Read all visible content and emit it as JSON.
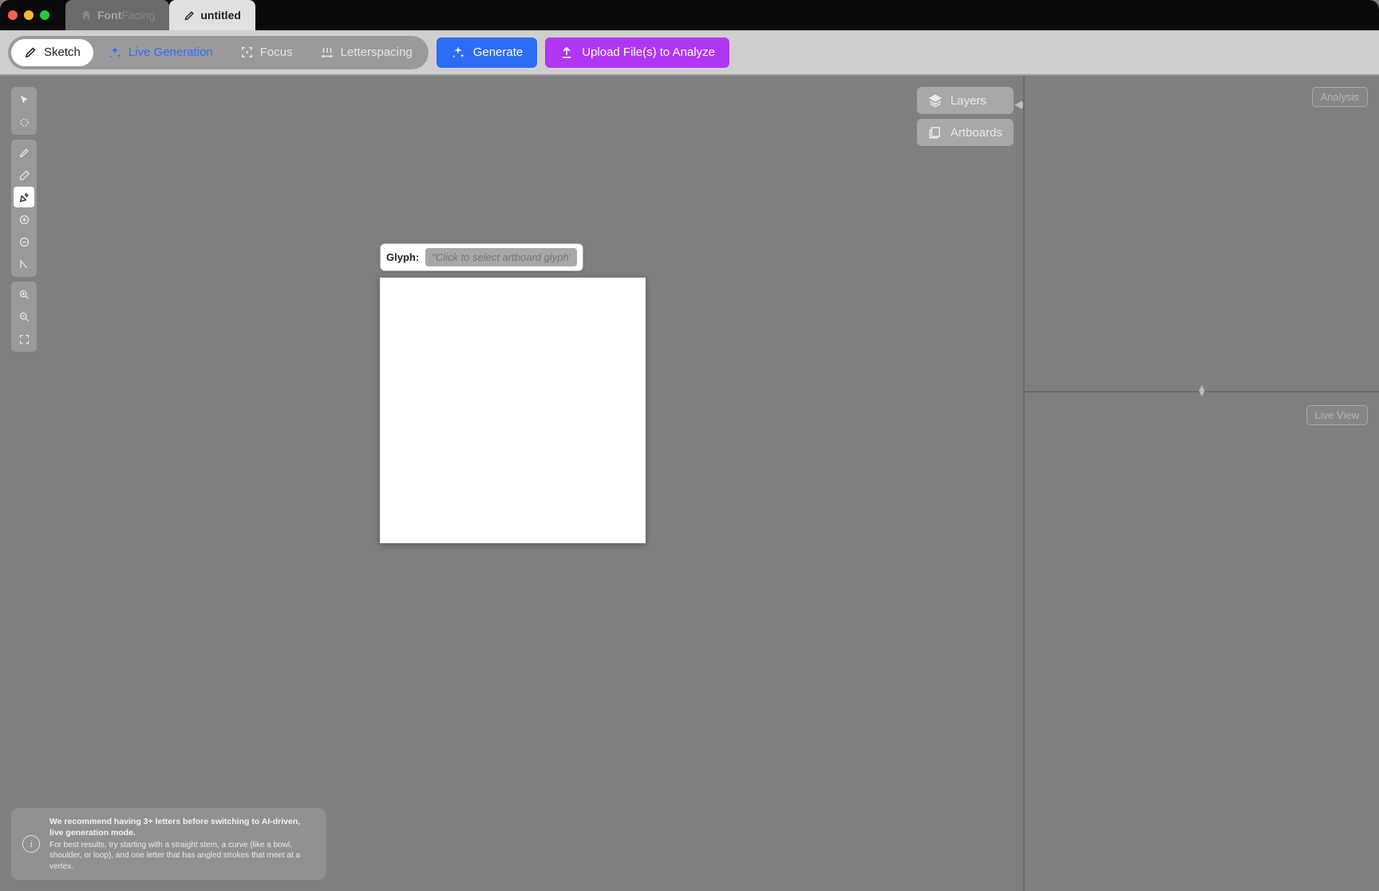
{
  "tabs": {
    "home_label_prefix": "Font",
    "home_label_suffix": "Facing",
    "active_label": "untitled"
  },
  "toolbar": {
    "modes": {
      "sketch": "Sketch",
      "live": "Live Generation",
      "focus": "Focus",
      "letterspacing": "Letterspacing"
    },
    "actions": {
      "generate": "Generate",
      "upload": "Upload File(s) to Analyze"
    }
  },
  "panels": {
    "layers": "Layers",
    "artboards": "Artboards",
    "analysis": "Analysis",
    "liveview": "Live View"
  },
  "artboard": {
    "glyph_label": "Glyph:",
    "glyph_placeholder": "\"Click to select artboard glyph\""
  },
  "hint": {
    "line1": "We recommend having 3+ letters before switching to AI-driven, live generation mode.",
    "line2": "For best results, try starting with a straight stem, a curve (like a bowl, shoulder, or loop), and one letter that has angled strokes that meet at a vertex."
  }
}
